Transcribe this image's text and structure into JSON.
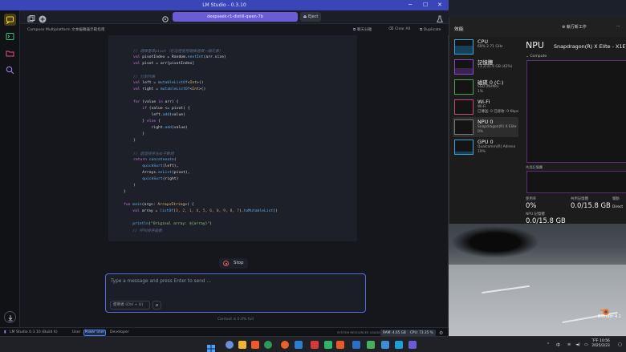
{
  "lmstudio": {
    "window_title": "LM Studio - 0.3.10",
    "model_pill": "deepseek-r1-distill-qwen-7b",
    "eject_label": "Eject",
    "chat_name": "Compose Multiplatform 文本編輯器示範指南",
    "actions": {
      "split": "聊天分離",
      "clear_all": "Clear All",
      "duplicate": "Duplicate"
    },
    "code_lines": [
      [
        [
          "// 選擇基準pivot（在這裡使用隨機選擇一個元素）",
          "cm"
        ]
      ],
      [
        [
          "val ",
          "kw"
        ],
        [
          "pivotIndex = Random.",
          "pl"
        ],
        [
          "nextInt",
          "fn"
        ],
        [
          "(arr.size)",
          "pl"
        ]
      ],
      [
        [
          "val ",
          "kw"
        ],
        [
          "pivot = arr[pivotIndex]",
          "pl"
        ]
      ],
      [
        [
          "",
          "pl"
        ]
      ],
      [
        [
          "// 分割列表",
          "cm"
        ]
      ],
      [
        [
          "val ",
          "kw"
        ],
        [
          "left = ",
          "pl"
        ],
        [
          "mutableListOf",
          "fn"
        ],
        [
          "<",
          "pl"
        ],
        [
          "Int",
          "ty"
        ],
        [
          ">()",
          "pl"
        ]
      ],
      [
        [
          "val ",
          "kw"
        ],
        [
          "right = ",
          "pl"
        ],
        [
          "mutableListOf",
          "fn"
        ],
        [
          "<",
          "pl"
        ],
        [
          "Int",
          "ty"
        ],
        [
          ">()",
          "pl"
        ]
      ],
      [
        [
          "",
          "pl"
        ]
      ],
      [
        [
          "for ",
          "kw"
        ],
        [
          "(value ",
          "pl"
        ],
        [
          "in ",
          "kw"
        ],
        [
          "arr) {",
          "pl"
        ]
      ],
      [
        [
          "    if ",
          "kw"
        ],
        [
          "(value <= pivot) {",
          "pl"
        ]
      ],
      [
        [
          "        left.",
          "pl"
        ],
        [
          "add",
          "fn"
        ],
        [
          "(value)",
          "pl"
        ]
      ],
      [
        [
          "    } ",
          "pl"
        ],
        [
          "else ",
          "kw"
        ],
        [
          "{",
          "pl"
        ]
      ],
      [
        [
          "        right.",
          "pl"
        ],
        [
          "add",
          "fn"
        ],
        [
          "(value)",
          "pl"
        ]
      ],
      [
        [
          "    }",
          "pl"
        ]
      ],
      [
        [
          "}",
          "pl"
        ]
      ],
      [
        [
          "",
          "pl"
        ]
      ],
      [
        [
          "// 遞迴排序左右子數組",
          "cm"
        ]
      ],
      [
        [
          "return ",
          "kw"
        ],
        [
          "concatenate",
          "fn"
        ],
        [
          "(",
          "pl"
        ]
      ],
      [
        [
          "    quickSort",
          "fn"
        ],
        [
          "(left),",
          "pl"
        ]
      ],
      [
        [
          "    Arrays.",
          "pl"
        ],
        [
          "asList",
          "fn"
        ],
        [
          "(pivot),",
          "pl"
        ]
      ],
      [
        [
          "    quickSort",
          "fn"
        ],
        [
          "(right)",
          "pl"
        ]
      ],
      [
        [
          ")",
          "pl"
        ]
      ],
      [
        [
          "}",
          "pl"
        ]
      ],
      [
        [
          "",
          "pl"
        ]
      ],
      [
        [
          "fun ",
          "kw"
        ],
        [
          "main",
          "fn"
        ],
        [
          "(args: ",
          "pl"
        ],
        [
          "Array",
          "ty"
        ],
        [
          "<",
          "pl"
        ],
        [
          "String",
          "ty"
        ],
        [
          ">) {",
          "pl"
        ]
      ],
      [
        [
          "    val ",
          "kw"
        ],
        [
          "array = ",
          "pl"
        ],
        [
          "listOf",
          "fn"
        ],
        [
          "(",
          "pl"
        ],
        [
          "3, 2, 1, 4, 5, 6, 0, 9, 8, 7",
          "nu"
        ],
        [
          ").",
          "pl"
        ],
        [
          "toMutableList",
          "fn"
        ],
        [
          "()",
          "pl"
        ]
      ],
      [
        [
          "",
          "pl"
        ]
      ],
      [
        [
          "    println",
          "fn"
        ],
        [
          "(",
          "pl"
        ],
        [
          "\"Original array: ${array}\"",
          "st"
        ],
        [
          ")",
          "pl"
        ]
      ],
      [
        [
          "    // 呼叫排序函數",
          "cm"
        ]
      ]
    ],
    "stop_label": "Stop",
    "input_placeholder": "Type a message and press Enter to send ...",
    "role_label": "使用者 (Ctrl + U)",
    "context_text": "Context is 0.0% full",
    "status": {
      "app": "LM Studio 0.3.10 (Build 6)",
      "mode_user": "User",
      "mode_power": "Power User",
      "mode_dev": "Developer",
      "sys_res": "SYSTEM RESOURCES USAGE:",
      "ram": "RAM: 4.65 GB",
      "cpu": "CPU: 73.35 %"
    }
  },
  "taskmanager": {
    "title": "效能",
    "run_task": "執行新工作",
    "items": [
      {
        "name": "CPU",
        "sub": "69% 2.71 GHz"
      },
      {
        "name": "記憶體",
        "sub": "13.2/31.6 GB (42%)"
      },
      {
        "name": "磁碟 0 (C:)",
        "sub": "SSD (NVMe)\n1%"
      },
      {
        "name": "Wi-Fi",
        "sub": "Wi-Fi\n已傳送: 0 已接收: 0 Kbps"
      },
      {
        "name": "NPU 0",
        "sub": "Snapdragon(R) X Elite\n0%"
      },
      {
        "name": "GPU 0",
        "sub": "Qualcomm(R) Adreno\n19%"
      }
    ],
    "detail": {
      "title": "NPU",
      "name": "Snapdragon(R) X Elite - X1E78",
      "compute_label": "Compute",
      "shared_label": "共用記憶體",
      "util_label": "使用率",
      "util_value": "0%",
      "shared_mem_label": "共用記憶體",
      "shared_mem_value": "0.0/15.8 GB",
      "drv_label": "驅動",
      "drv_value": "Direct",
      "npu_mem_label": "NPU 記憶體",
      "npu_mem_value": "0.0/15.8 GB"
    }
  },
  "desktop": {
    "blender_label": "Blender 4.1"
  },
  "taskbar": {
    "time": "下午 10:56",
    "date": "2025/2/23",
    "lang": "中"
  }
}
